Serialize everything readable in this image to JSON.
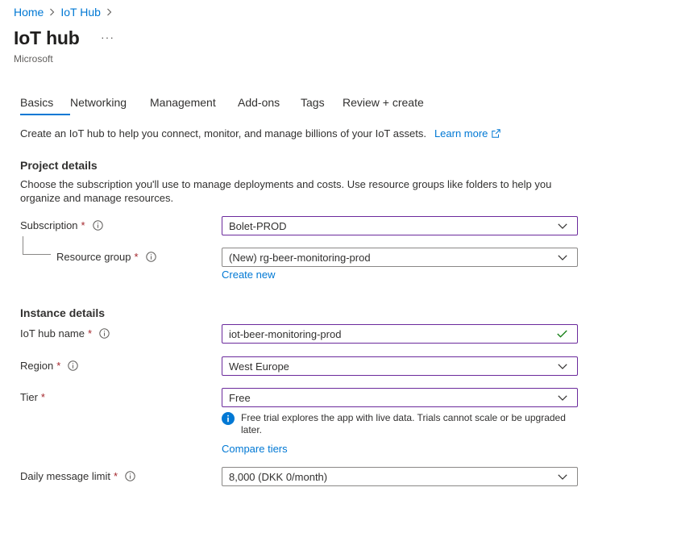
{
  "breadcrumb": [
    {
      "label": "Home"
    },
    {
      "label": "IoT Hub"
    }
  ],
  "page": {
    "title": "IoT hub",
    "more": "···",
    "publisher": "Microsoft"
  },
  "tabs": [
    {
      "label": "Basics",
      "active": true
    },
    {
      "label": "Networking"
    },
    {
      "label": "Management"
    },
    {
      "label": "Add-ons"
    },
    {
      "label": "Tags"
    },
    {
      "label": "Review + create"
    }
  ],
  "intro": {
    "text": "Create an IoT hub to help you connect, monitor, and manage billions of your IoT assets.",
    "learn_more": "Learn more"
  },
  "project": {
    "heading": "Project details",
    "description": "Choose the subscription you'll use to manage deployments and costs. Use resource groups like folders to help you organize and manage resources.",
    "subscription": {
      "label": "Subscription",
      "required": "*",
      "value": "Bolet-PROD"
    },
    "resource_group": {
      "label": "Resource group",
      "required": "*",
      "value": "(New) rg-beer-monitoring-prod",
      "create_new": "Create new"
    }
  },
  "instance": {
    "heading": "Instance details",
    "hub_name": {
      "label": "IoT hub name",
      "required": "*",
      "value": "iot-beer-monitoring-prod"
    },
    "region": {
      "label": "Region",
      "required": "*",
      "value": "West Europe"
    },
    "tier": {
      "label": "Tier",
      "required": "*",
      "value": "Free",
      "info": "Free trial explores the app with live data. Trials cannot scale or be upgraded later.",
      "compare": "Compare tiers"
    },
    "daily_limit": {
      "label": "Daily message limit",
      "required": "*",
      "value": "8,000 (DKK 0/month)"
    }
  },
  "colors": {
    "accent": "#0078d4",
    "required": "#a4262c",
    "valid_check": "#107c10",
    "focused_border": "#6b2a9c"
  },
  "icons": {
    "info": "info-circle-icon",
    "chevron": "chevron-down-icon",
    "check": "checkmark-icon",
    "external": "external-link-icon"
  }
}
